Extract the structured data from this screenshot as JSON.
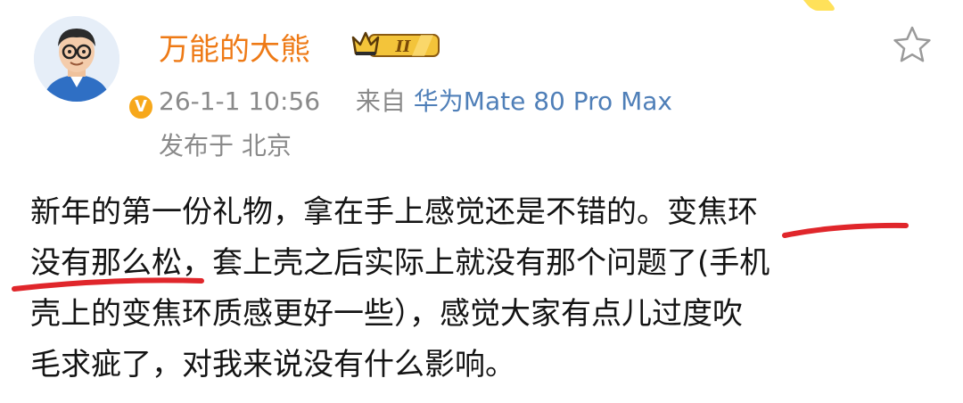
{
  "user": {
    "name": "万能的大熊",
    "level_badge": "II",
    "verified_badge": "V"
  },
  "meta": {
    "time": "26-1-1 10:56",
    "source_prefix": "来自",
    "device": "华为Mate 80 Pro Max",
    "location": "发布于 北京"
  },
  "icons": {
    "favorite": "star-outline-icon",
    "level": "crown-level-badge-icon",
    "verified": "verified-v-badge-icon"
  },
  "colors": {
    "name": "#ee7a16",
    "device_link": "#4f7fb8",
    "meta": "#8a8a8a",
    "highlight_underline": "#e0262b",
    "verified_badge": "#f7a81b"
  },
  "post": {
    "lines": [
      "新年的第一份礼物，拿在手上感觉还是不错的。变焦环",
      "没有那么松，套上壳之后实际上就没有那个问题了(手机",
      "壳上的变焦环质感更好一些），感觉大家有点儿过度吹",
      "毛求疵了，对我来说没有什么影响。"
    ],
    "highlighted_phrase": "变焦环没有那么松"
  }
}
